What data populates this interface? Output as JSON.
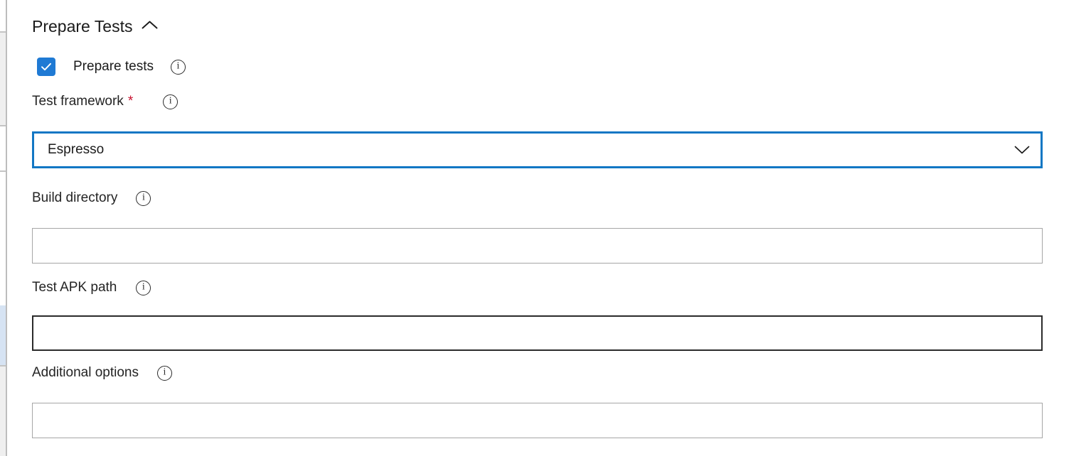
{
  "section": {
    "title": "Prepare Tests",
    "collapse_icon": "chevron-up-icon",
    "expanded": true
  },
  "checkbox": {
    "label": "Prepare tests",
    "checked": true,
    "info_icon": "info-icon",
    "check_icon": "checkmark-icon",
    "color": "#1f7ad4"
  },
  "fields": [
    {
      "label": "Test framework",
      "required": true,
      "required_marker": "*",
      "info_icon": "info-icon",
      "control": "select",
      "value": "Espresso",
      "placeholder": "",
      "chevron_icon": "chevron-down-icon",
      "state": "focused",
      "border_color": "#1277c4"
    },
    {
      "label": "Build directory",
      "required": false,
      "info_icon": "info-icon",
      "control": "text",
      "value": "",
      "placeholder": "",
      "state": "default",
      "border_color": "#a6a6a6"
    },
    {
      "label": "Test APK path",
      "required": false,
      "info_icon": "info-icon",
      "control": "text",
      "value": "",
      "placeholder": "",
      "state": "hover",
      "border_color": "#2b2b2b"
    },
    {
      "label": "Additional options",
      "required": false,
      "info_icon": "info-icon",
      "control": "text",
      "value": "",
      "placeholder": "",
      "state": "default",
      "border_color": "#a6a6a6"
    }
  ],
  "colors": {
    "accent": "#1277c4",
    "checkbox": "#1f7ad4",
    "required": "#c8102e",
    "text": "#1b1b1b",
    "border_default": "#a6a6a6",
    "border_hover": "#2b2b2b",
    "rail_selected": "#d6e3f3"
  }
}
